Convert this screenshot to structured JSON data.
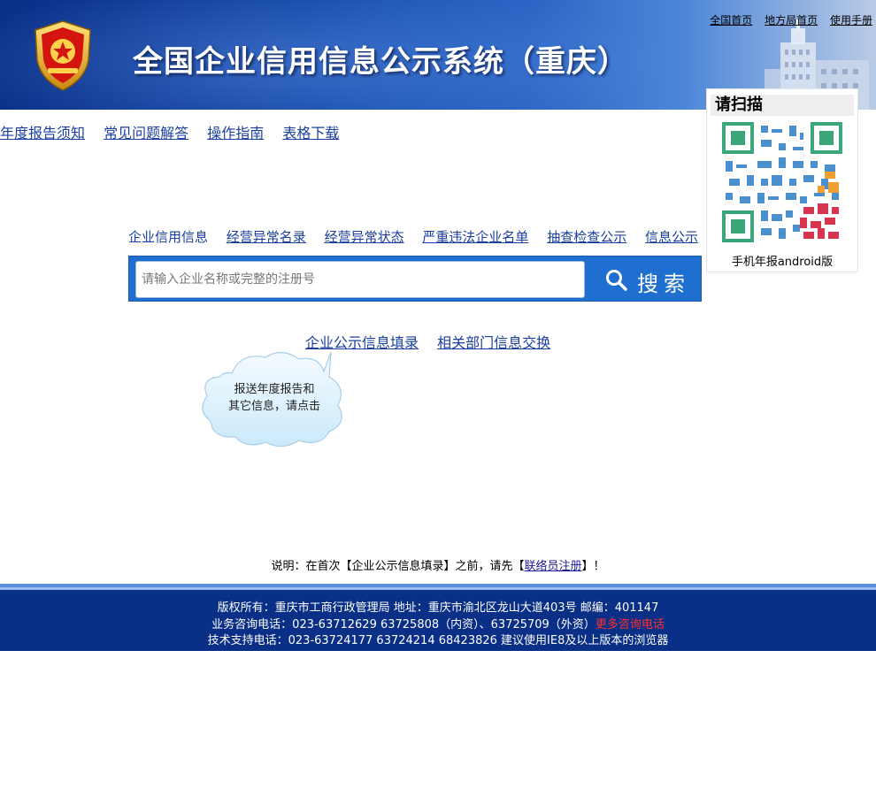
{
  "header": {
    "title": "全国企业信用信息公示系统（重庆）",
    "top_links": [
      "全国首页",
      "地方局首页",
      "使用手册"
    ]
  },
  "nav": {
    "items": [
      "年度报告须知",
      "常见问题解答",
      "操作指南",
      "表格下载"
    ]
  },
  "qr": {
    "heading": "请扫描",
    "caption": "手机年报android版"
  },
  "tabs": {
    "items": [
      "企业信用信息",
      "经营异常名录",
      "经营异常状态",
      "严重违法企业名单",
      "抽查检查公示",
      "信息公示"
    ]
  },
  "search": {
    "placeholder": "请输入企业名称或完整的注册号",
    "button_label": "搜索"
  },
  "fill_links": [
    "企业公示信息填录",
    "相关部门信息交换"
  ],
  "cloud": {
    "line1": "报送年度报告和",
    "line2": "其它信息，请点击"
  },
  "note": {
    "prefix": "说明：在首次【企业公示信息填录】之前，请先【",
    "link": "联络员注册",
    "suffix": "】！"
  },
  "footer": {
    "line1": "版权所有：重庆市工商行政管理局  地址：重庆市渝北区龙山大道403号  邮编：401147",
    "line2": "业务咨询电话：023-63712629 63725808（内资）、63725709（外资）",
    "line2_link": "更多咨询电话",
    "line3": "技术支持电话：023-63724177 63724214 68423826 建议使用IE8及以上版本的浏览器"
  },
  "colors": {
    "header_blue": "#0a2f86",
    "link_blue": "#1a3fa0",
    "search_blue": "#1f6fd0",
    "footer_red": "#ff3030"
  }
}
